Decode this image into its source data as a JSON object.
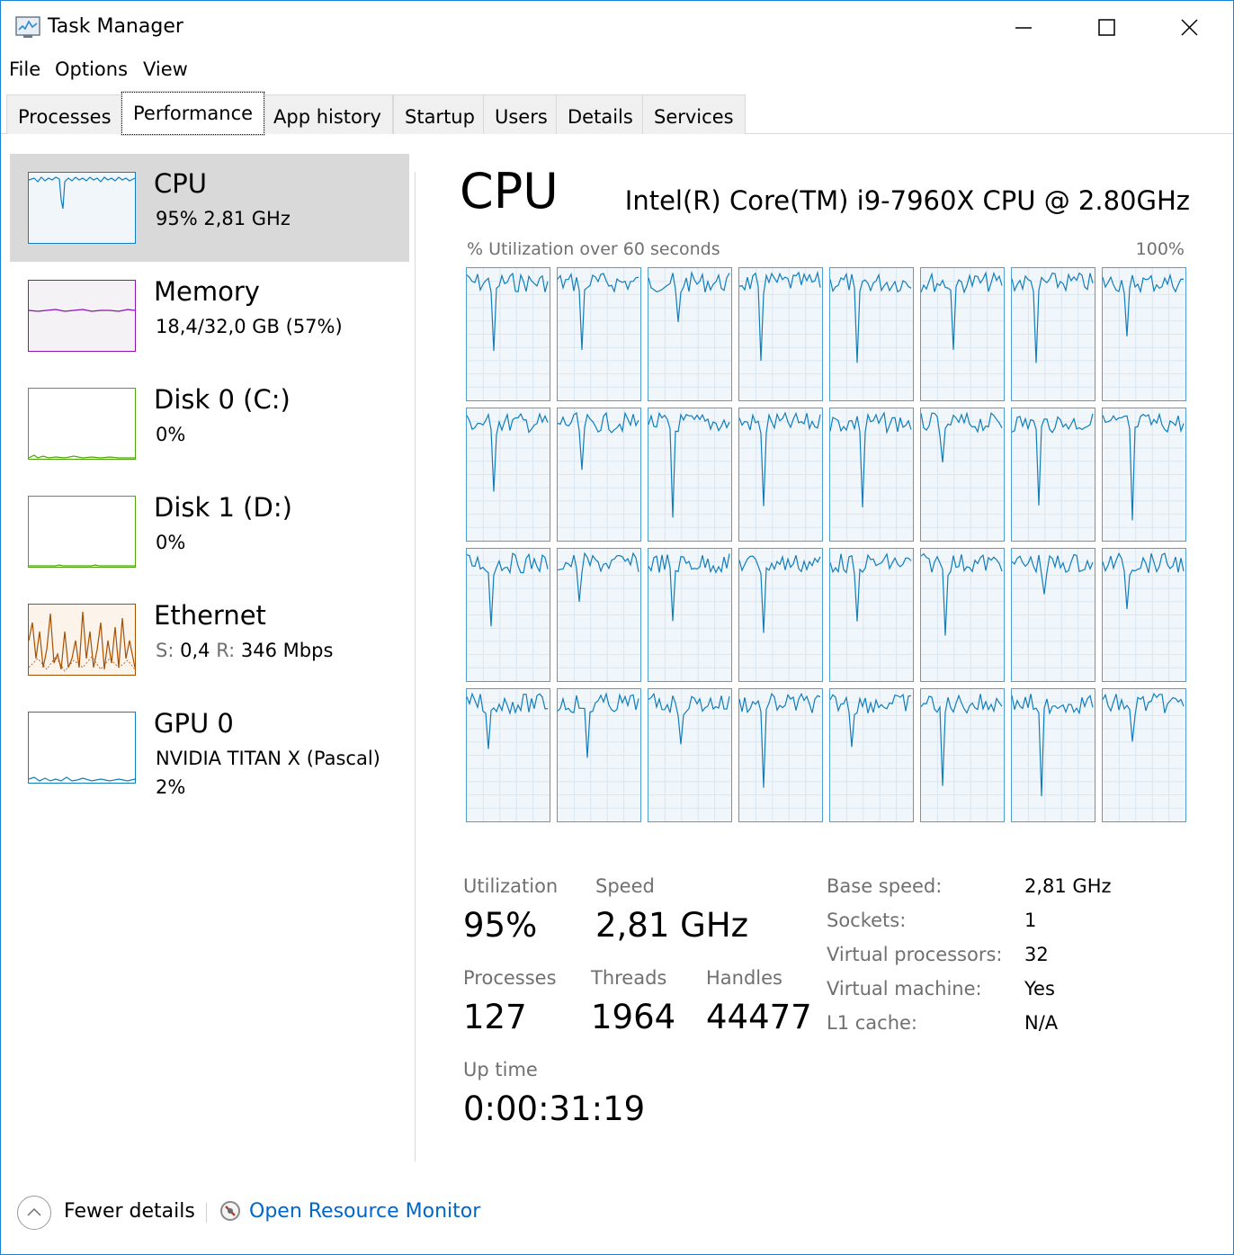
{
  "window": {
    "title": "Task Manager"
  },
  "menu": [
    "File",
    "Options",
    "View"
  ],
  "tabs": [
    "Processes",
    "Performance",
    "App history",
    "Startup",
    "Users",
    "Details",
    "Services"
  ],
  "active_tab": "Performance",
  "sidebar": [
    {
      "title": "CPU",
      "sub": "95%  2,81 GHz",
      "color": "#117dbb",
      "selected": true
    },
    {
      "title": "Memory",
      "sub": "18,4/32,0 GB (57%)",
      "color": "#8b12ae"
    },
    {
      "title": "Disk 0 (C:)",
      "sub": "0%",
      "color": "#4da60c"
    },
    {
      "title": "Disk 1 (D:)",
      "sub": "0%",
      "color": "#4da60c"
    },
    {
      "title": "Ethernet",
      "sub_send_label": "S:",
      "sub_send": "0,4",
      "sub_recv_label": "R:",
      "sub_recv": "346 Mbps",
      "color": "#a74f01"
    },
    {
      "title": "GPU 0",
      "sub": "NVIDIA TITAN X (Pascal)",
      "sub2": "2%",
      "color": "#117dbb"
    }
  ],
  "main": {
    "title": "CPU",
    "cpu_name": "Intel(R) Core(TM) i9-7960X CPU @ 2.80GHz",
    "graph_label": "% Utilization over 60 seconds",
    "graph_max": "100%",
    "logical_processors": 32,
    "graph_color": "#117dbb"
  },
  "stats": {
    "utilization_label": "Utilization",
    "utilization": "95%",
    "speed_label": "Speed",
    "speed": "2,81 GHz",
    "processes_label": "Processes",
    "processes": "127",
    "threads_label": "Threads",
    "threads": "1964",
    "handles_label": "Handles",
    "handles": "44477",
    "uptime_label": "Up time",
    "uptime": "0:00:31:19"
  },
  "details": [
    {
      "label": "Base speed:",
      "value": "2,81 GHz"
    },
    {
      "label": "Sockets:",
      "value": "1"
    },
    {
      "label": "Virtual processors:",
      "value": "32"
    },
    {
      "label": "Virtual machine:",
      "value": "Yes"
    },
    {
      "label": "L1 cache:",
      "value": "N/A"
    }
  ],
  "footer": {
    "fewer_details": "Fewer details",
    "resource_monitor": "Open Resource Monitor"
  }
}
